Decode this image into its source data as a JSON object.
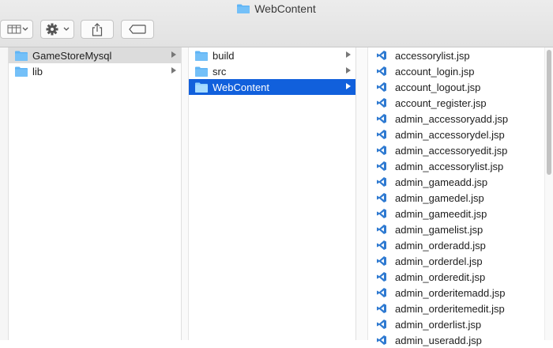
{
  "window": {
    "title": "WebContent",
    "title_icon": "folder-icon"
  },
  "toolbar": {
    "view_button_icon": "column-view-icon",
    "action_button_icon": "gear-icon",
    "share_button_icon": "share-icon",
    "tag_button_icon": "tag-icon"
  },
  "column1": {
    "items": [
      {
        "label": "GameStoreMysql",
        "has_children": true,
        "selected": "gray"
      },
      {
        "label": "lib",
        "has_children": true
      }
    ]
  },
  "column2": {
    "items": [
      {
        "label": "build",
        "has_children": true
      },
      {
        "label": "src",
        "has_children": true
      },
      {
        "label": "WebContent",
        "has_children": true,
        "selected": "blue"
      }
    ]
  },
  "column3": {
    "items": [
      "accessorylist.jsp",
      "account_login.jsp",
      "account_logout.jsp",
      "account_register.jsp",
      "admin_accessoryadd.jsp",
      "admin_accessorydel.jsp",
      "admin_accessoryedit.jsp",
      "admin_accessorylist.jsp",
      "admin_gameadd.jsp",
      "admin_gamedel.jsp",
      "admin_gameedit.jsp",
      "admin_gamelist.jsp",
      "admin_orderadd.jsp",
      "admin_orderdel.jsp",
      "admin_orderedit.jsp",
      "admin_orderitemadd.jsp",
      "admin_orderitemedit.jsp",
      "admin_orderlist.jsp",
      "admin_useradd.jsp"
    ]
  },
  "colors": {
    "selection_blue": "#1160dc",
    "selection_gray": "#dcdcdc",
    "folder_blue": "#5fb4f5"
  }
}
